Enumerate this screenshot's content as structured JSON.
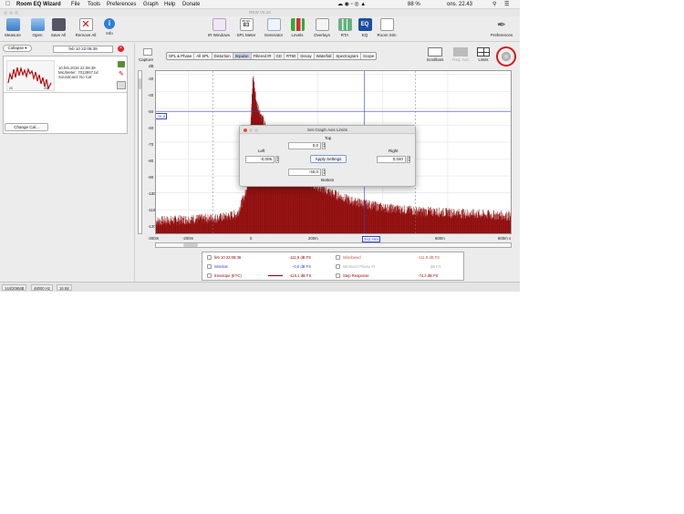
{
  "menubar": {
    "app_name": "Room EQ Wizard",
    "menus": [
      "File",
      "Tools",
      "Preferences",
      "Graph",
      "Help",
      "Donate"
    ],
    "status": "88 %",
    "clock": "ons. 22.43"
  },
  "window": {
    "title": "REW V5.16"
  },
  "toolbar": {
    "left": [
      "Measure",
      "Open",
      "Save All",
      "Remove All",
      "Info"
    ],
    "center": [
      "IR Windows",
      "SPL Meter",
      "Generator",
      "Levels",
      "Overlays",
      "RTA",
      "EQ",
      "Room Sim"
    ],
    "spl_badge_top": "dB SPL",
    "spl_badge_value": "83",
    "eq_badge": "EQ",
    "right": "Preferences"
  },
  "left_panel": {
    "collapse_label": "Collapse",
    "measurement_name": "feb 10 22:08:39",
    "meas_date": "10.feb.2016 22.08.39",
    "meas_mic": "Mic/Meter: 7013957.txt",
    "meas_soundcard": "Soundcard: No Cal",
    "thumb_left": "20",
    "thumb_right": "20k",
    "change_cal_label": "Change Cal..."
  },
  "graph": {
    "capture_label": "Capture",
    "tabs": [
      "SPL & Phase",
      "All SPL",
      "Distortion",
      "Impulse",
      "Filtered IR",
      "GD",
      "RT60",
      "Decay",
      "Waterfall",
      "Spectrogram",
      "Scope"
    ],
    "active_tab": "Impulse",
    "right_buttons": [
      "Scrollbars",
      "Freq. Axis",
      "Limits"
    ],
    "unit_label": "dB",
    "cursor_y_value": "-51,8",
    "cursor_x_value": "342,4ms"
  },
  "chart_data": {
    "type": "line",
    "xlabel": "",
    "ylabel": "dB",
    "x_ticks": [
      "-300m",
      "-200m",
      "0",
      "200m",
      "400m",
      "600m",
      "800m s"
    ],
    "y_ticks": [
      "-30",
      "-40",
      "-50",
      "-60",
      "-70",
      "-80",
      "-90",
      "-100",
      "-110",
      "-120"
    ],
    "xlim": [
      -0.3,
      0.8
    ],
    "ylim": [
      -125,
      -28
    ],
    "series": [
      {
        "values_desc": "impulse envelope",
        "x": [
          -0.3,
          -0.2,
          -0.1,
          -0.05,
          -0.02,
          0.0,
          0.01,
          0.03,
          0.06,
          0.1,
          0.15,
          0.2,
          0.3,
          0.4,
          0.5,
          0.6,
          0.7,
          0.8
        ],
        "y": [
          -118,
          -117,
          -116,
          -114,
          -100,
          -32,
          -48,
          -58,
          -74,
          -84,
          -92,
          -98,
          -106,
          -110,
          -112,
          -113,
          -114,
          -115
        ]
      }
    ],
    "color": "#8b0000"
  },
  "legend": {
    "rows": [
      {
        "left_label": "feb 10 22:08:39",
        "left_value": "-111,9 dB FS",
        "right_label": "Windowed",
        "right_value": "-111,9 dB FS"
      },
      {
        "left_label": "Window",
        "left_value": "-0,0 dB FS",
        "right_label": "Minimum Phase IR",
        "right_value": "dB FS"
      },
      {
        "left_label": "Envelope (ETC)",
        "left_value": "-110,1 dB FS",
        "right_label": "Step Response",
        "right_value": "-74,3 dB FS"
      }
    ]
  },
  "dialog": {
    "title": "Set Graph Axis Limits",
    "top_label": "Top",
    "top_value": "0,0",
    "left_label": "Left",
    "left_value": "-0,005",
    "right_label": "Right",
    "right_value": "0,040",
    "bottom_label": "Bottom",
    "bottom_value": "-40,0",
    "apply_label": "Apply Settings"
  },
  "statusbar": [
    "144/206MB",
    "48000 Hz",
    "16 Bit"
  ],
  "colors": {
    "trace": "#8b0000",
    "cursor": "#3344cc",
    "highlight": "#cc0000"
  }
}
